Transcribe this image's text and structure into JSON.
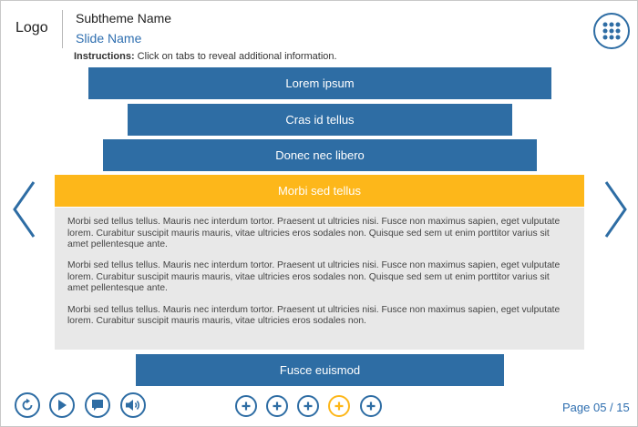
{
  "header": {
    "logo": "Logo",
    "subtheme": "Subtheme Name",
    "slide_name": "Slide Name",
    "instructions_label": "Instructions:",
    "instructions_text": " Click on tabs to reveal additional information."
  },
  "menu_icon": "grid-icon",
  "navigation": {
    "prev_icon": "chevron-left-icon",
    "next_icon": "chevron-right-icon"
  },
  "tabs": [
    {
      "label": "Lorem ipsum",
      "active": false
    },
    {
      "label": "Cras id tellus",
      "active": false
    },
    {
      "label": "Donec nec libero",
      "active": false
    },
    {
      "label": "Morbi sed tellus",
      "active": true
    },
    {
      "label": "Fusce euismod",
      "active": false
    }
  ],
  "panel": {
    "paragraphs": [
      "Morbi sed tellus tellus. Mauris nec interdum tortor. Praesent ut ultricies nisi. Fusce non maximus sapien, eget vulputate lorem. Curabitur suscipit mauris mauris, vitae ultricies eros sodales non. Quisque sed sem ut enim porttitor varius sit amet pellentesque ante.",
      "Morbi sed tellus tellus. Mauris nec interdum tortor. Praesent ut ultricies nisi. Fusce non maximus sapien, eget vulputate lorem. Curabitur suscipit mauris mauris, vitae ultricies eros sodales non. Quisque sed sem ut enim porttitor varius sit amet pellentesque ante.",
      "Morbi sed tellus tellus. Mauris nec interdum tortor. Praesent ut ultricies nisi. Fusce non maximus sapien, eget vulputate lorem. Curabitur suscipit mauris mauris, vitae ultricies eros sodales non."
    ]
  },
  "controls": [
    {
      "name": "replay-button",
      "icon": "replay-icon"
    },
    {
      "name": "play-button",
      "icon": "play-icon"
    },
    {
      "name": "transcript-button",
      "icon": "speech-bubble-icon"
    },
    {
      "name": "audio-button",
      "icon": "speaker-icon"
    }
  ],
  "tab_dots": [
    {
      "active": false
    },
    {
      "active": false
    },
    {
      "active": false
    },
    {
      "active": true
    },
    {
      "active": false
    }
  ],
  "footer": {
    "page": "Page 05 / 15"
  },
  "colors": {
    "primary": "#2e6da4",
    "accent": "#fdb71a",
    "panel_bg": "#e8e8e8",
    "link": "#2f6fb0"
  }
}
